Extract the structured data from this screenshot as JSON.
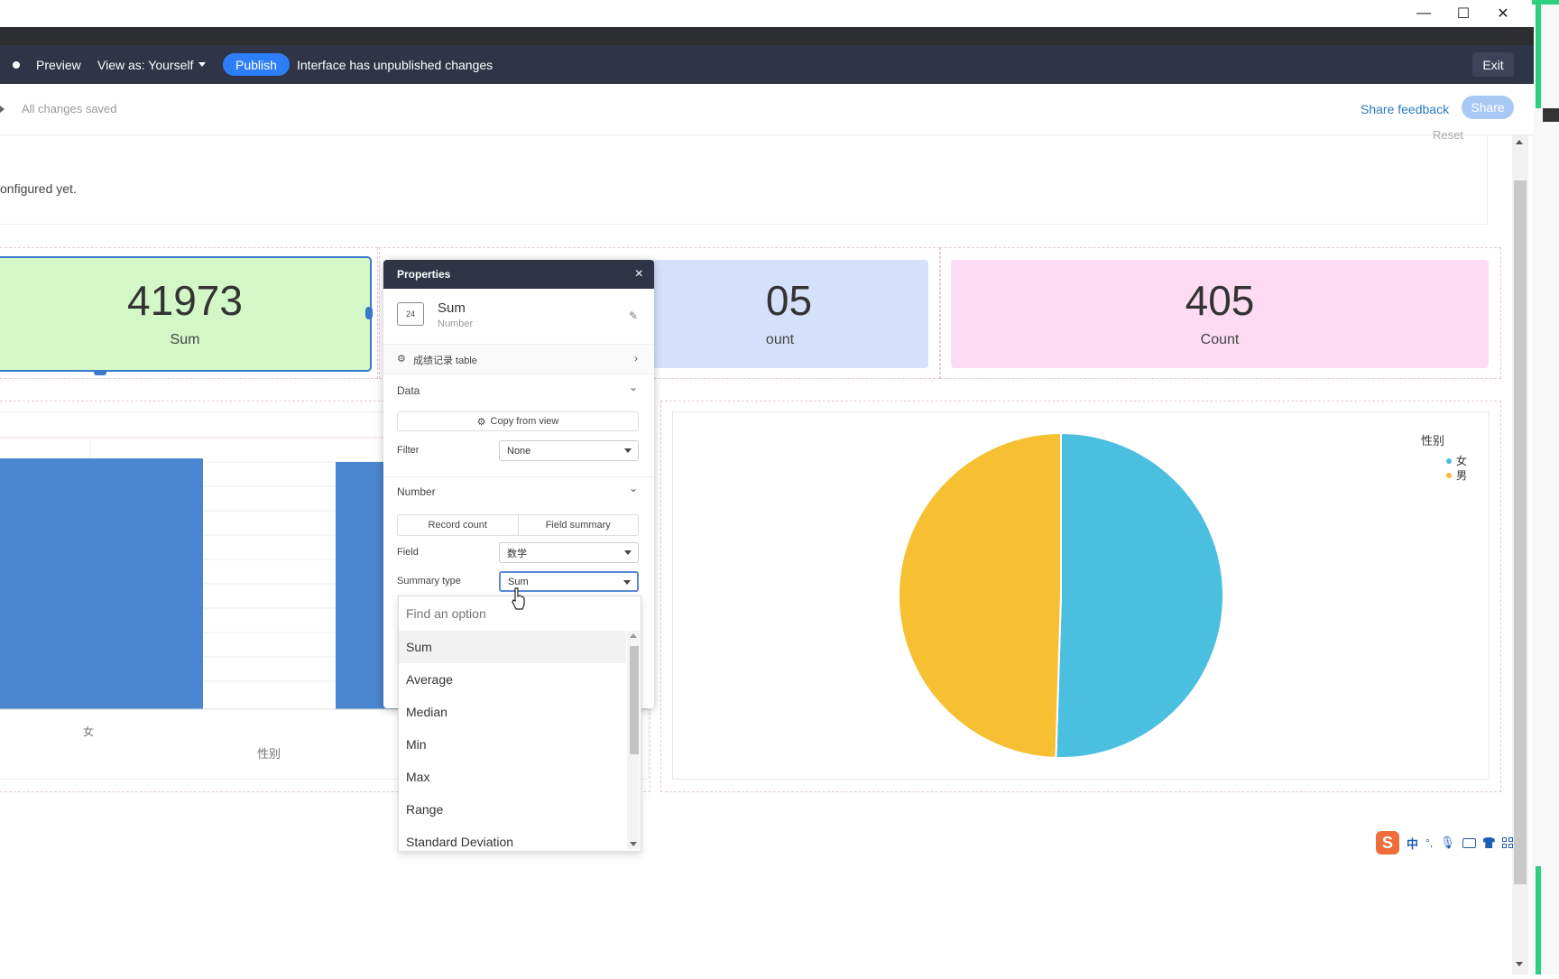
{
  "header": {
    "preview": "Preview",
    "view_as": "View as: Yourself",
    "publish": "Publish",
    "unpublished": "Interface has unpublished changes",
    "exit": "Exit"
  },
  "toolbar": {
    "saved": "All changes saved",
    "share_feedback": "Share feedback",
    "share": "Share"
  },
  "canvas": {
    "reset": "Reset",
    "not_configured": "onfigured yet."
  },
  "number_cards": [
    {
      "value": "41973",
      "label": "Sum",
      "color": "#d3f7c7"
    },
    {
      "value": "05",
      "label": "ount",
      "color": "#d5e1fb"
    },
    {
      "value": "405",
      "label": "Count",
      "color": "#fddcf3"
    }
  ],
  "bar_chart": {
    "xlabel": "性别",
    "tick_nv": "女"
  },
  "pie_chart": {
    "legend_title": "性别",
    "legend": [
      {
        "name": "女",
        "color": "#4bbfe0"
      },
      {
        "name": "男",
        "color": "#f7bf32"
      }
    ],
    "chart_data": {
      "type": "pie",
      "categories": [
        "女",
        "男"
      ],
      "values": [
        50.5,
        49.5
      ]
    }
  },
  "properties": {
    "title": "Properties",
    "close": "×",
    "element_name": "Sum",
    "element_type": "Number",
    "badge": "24",
    "source": "成绩记录 table",
    "data_section": "Data",
    "copy_from_view": "Copy from view",
    "filter_label": "Filter",
    "filter_value": "None",
    "number_section": "Number",
    "tab_record_count": "Record count",
    "tab_field_summary": "Field summary",
    "field_label": "Field",
    "field_value": "数学",
    "summary_type_label": "Summary type",
    "summary_type_value": "Sum"
  },
  "dropdown": {
    "placeholder": "Find an option",
    "options": [
      "Sum",
      "Average",
      "Median",
      "Min",
      "Max",
      "Range",
      "Standard Deviation"
    ]
  },
  "window": {
    "minimize": "—",
    "maximize": "☐",
    "close": "✕"
  },
  "ime": {
    "lang": "中",
    "punct": "°,"
  }
}
